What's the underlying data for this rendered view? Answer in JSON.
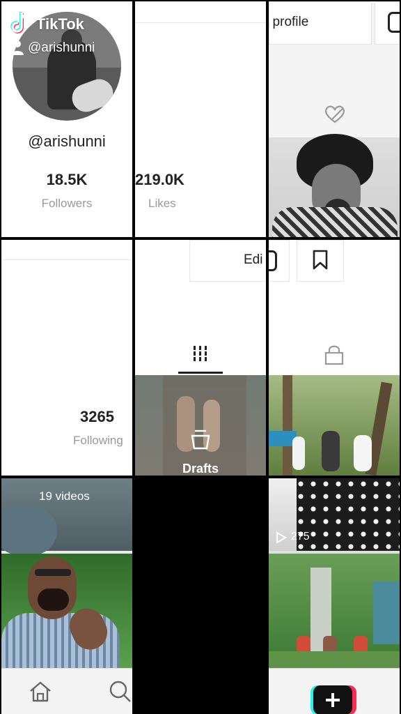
{
  "watermark": {
    "brand": "TikTok",
    "handle": "@arishunni"
  },
  "profile": {
    "username": "@arishunni",
    "followers_count": "18.5K",
    "followers_label": "Followers",
    "likes_count": "219.0K",
    "likes_label": "Likes",
    "following_count": "3265",
    "following_label": "Following"
  },
  "buttons": {
    "edit_profile_label": "t profile",
    "edit_label": "Edi"
  },
  "tabs": {
    "videos_icon": "grid-icon",
    "private_icon": "lock-icon",
    "liked_icon": "heart-hidden-icon",
    "bookmark_icon": "bookmark-icon",
    "instagram_icon": "instagram-icon"
  },
  "drafts": {
    "label": "Drafts",
    "count": "19 videos"
  },
  "video": {
    "views": "275"
  },
  "bottom_nav": {
    "home_icon": "home-icon",
    "search_icon": "search-icon",
    "create_icon": "plus-icon"
  }
}
